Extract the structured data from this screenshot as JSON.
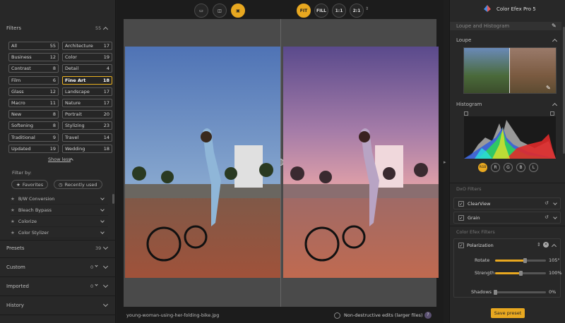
{
  "left": {
    "filters_label": "Filters",
    "filters_count": "55",
    "filter_grid": [
      {
        "name": "All",
        "count": "55"
      },
      {
        "name": "Architecture",
        "count": "17"
      },
      {
        "name": "Business",
        "count": "12"
      },
      {
        "name": "Color",
        "count": "19"
      },
      {
        "name": "Contrast",
        "count": "8"
      },
      {
        "name": "Detail",
        "count": "4"
      },
      {
        "name": "Film",
        "count": "6"
      },
      {
        "name": "Fine Art",
        "count": "18"
      },
      {
        "name": "Glass",
        "count": "12"
      },
      {
        "name": "Landscape",
        "count": "17"
      },
      {
        "name": "Macro",
        "count": "11"
      },
      {
        "name": "Nature",
        "count": "17"
      },
      {
        "name": "New",
        "count": "8"
      },
      {
        "name": "Portrait",
        "count": "20"
      },
      {
        "name": "Softening",
        "count": "8"
      },
      {
        "name": "Stylizing",
        "count": "23"
      },
      {
        "name": "Traditional",
        "count": "9"
      },
      {
        "name": "Travel",
        "count": "14"
      },
      {
        "name": "Updated",
        "count": "19"
      },
      {
        "name": "Wedding",
        "count": "18"
      }
    ],
    "selected_filter": "Fine Art",
    "show_less": "Show less",
    "filter_by": "Filter by:",
    "favorites": "Favorites",
    "recently_used": "Recently used",
    "filter_list": [
      "B/W Conversion",
      "Bleach Bypass",
      "Colorize",
      "Color Stylizer"
    ],
    "presets_label": "Presets",
    "presets_count": "39",
    "custom_label": "Custom",
    "custom_count": "0",
    "imported_label": "Imported",
    "imported_count": "0",
    "history_label": "History"
  },
  "toolbar": {
    "zoom_buttons": [
      "FIT",
      "FILL",
      "1:1",
      "2:1"
    ],
    "active_zoom": "FIT"
  },
  "footer": {
    "filename": "young-woman-using-her-folding-bike.jpg",
    "nondestructive": "Non-destructive edits (larger files)"
  },
  "right": {
    "app_title": "Color Efex Pro 5",
    "loupe_histogram": "Loupe and Histogram",
    "loupe": "Loupe",
    "histogram": "Histogram",
    "channels": [
      "RGB",
      "R",
      "G",
      "B",
      "L"
    ],
    "dxo_filters": "DxO Filters",
    "dxo_list": [
      "ClearView",
      "Grain"
    ],
    "cefex_filters": "Color Efex Filters",
    "active_filter": "Polarization",
    "sliders": [
      {
        "label": "Rotate",
        "value": "105°",
        "fill": 0.58
      },
      {
        "label": "Strength",
        "value": "100%",
        "fill": 0.5
      },
      {
        "label": "Shadows",
        "value": "0%",
        "fill": 0.0
      }
    ],
    "save_preset": "Save preset"
  },
  "colors": {
    "accent": "#e8a820",
    "panel": "#282828",
    "bg": "#1c1c1c"
  }
}
